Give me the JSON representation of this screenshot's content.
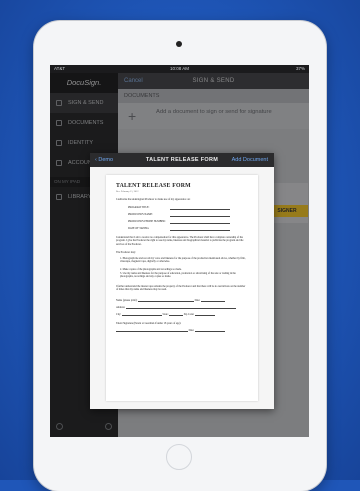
{
  "status_bar": {
    "carrier": "AT&T",
    "time": "10:08 AM",
    "battery": "37%"
  },
  "app_logo": "DocuSign.",
  "sidebar": {
    "items": [
      {
        "label": "SIGN & SEND",
        "icon": "pen-icon",
        "active": true
      },
      {
        "label": "DOCUMENTS",
        "icon": "folder-icon",
        "active": false
      },
      {
        "label": "IDENTITY",
        "icon": "person-icon",
        "active": false
      },
      {
        "label": "ACCOUNT",
        "icon": "gear-icon",
        "active": false
      }
    ],
    "section_label": "ON MY IPAD",
    "section_items": [
      {
        "label": "LIBRARY",
        "icon": "library-icon"
      }
    ]
  },
  "main": {
    "cancel_label": "Cancel",
    "title": "SIGN & SEND",
    "documents_heading": "DOCUMENTS",
    "add_doc_text": "Add a document to sign or send for signature",
    "yellow_button": "SIGNER"
  },
  "modal": {
    "back_label": "Demo",
    "title": "TALENT RELEASE FORM",
    "add_label": "Add Document"
  },
  "paper": {
    "title": "TALENT RELEASE FORM",
    "date": "Rev. February 15, 2012",
    "intro": "I authorize the undersigned Producer to make use of my appearance on:",
    "fields": [
      "PROGRAM TITLE:",
      "PRODUCER'S NAME:",
      "PRODUCER'S PHONE NUMBER:",
      "DATE OF TAPING:"
    ],
    "para1": "I understand that I am to receive no compensation for this appearance. The Producer shall have complete ownership of the program. I give the Producer the right to use my name, likeness and biographical material to publicize the program and the services of the Producer.",
    "para2": "The Producer may:",
    "list": [
      "1.  Photograph me and record my voice and likeness for the purpose of the production mentioned above, whether by film, videotape, magnetic tape, digitally or otherwise.",
      "2.  Make copies of the photographs and recordings so made.",
      "3.  Use my name and likeness for the purpose of education, promotion or advertising of the sale or trading in the photographs, recordings and any copies so made."
    ],
    "para3": "I further understand the master tape remains the property of the Producer and that there will be no restrictions on the number of times that my name and likeness may be used.",
    "name_label": "Name (please print):",
    "date_label": "Date:",
    "address_label": "Address:",
    "city_label": "City:",
    "state_label": "State:",
    "zip_label": "Zip Code:",
    "signature_label": "Talent Signature (Parent or Guardian if under 18 years of age):",
    "date2_label": "Date:"
  }
}
